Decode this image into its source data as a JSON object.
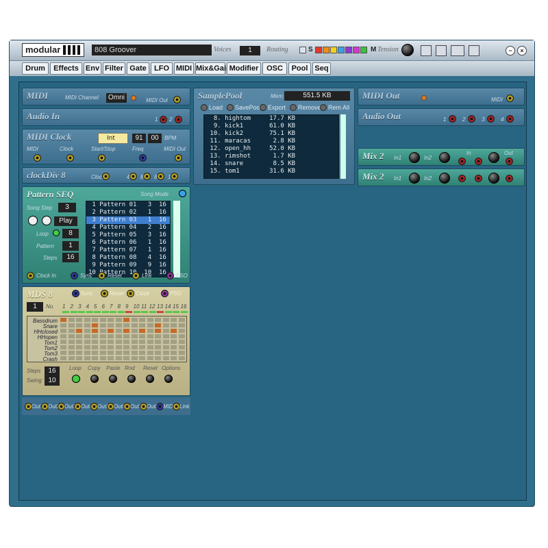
{
  "title": {
    "logo": "modular",
    "patch": "808 Groover",
    "voices_label": "Voices",
    "voices": "1",
    "routing_label": "Routing",
    "s": "S",
    "m": "M",
    "tension_label": "Tension"
  },
  "colors": {
    "rack": "#276582",
    "tan": "#c9c298",
    "teal": "#3f9586",
    "cable_yellow": "#d8c23a",
    "cable_red": "#b0282a",
    "cable_blue": "#3a4ec4"
  },
  "routing_swatches": [
    "#d9e4ee",
    "#e23a2a",
    "#f08a1a",
    "#f2d21a",
    "#3aa0e8",
    "#8a3ad0",
    "#d03ad0",
    "#3ac23a"
  ],
  "toolbar_icons": [
    "disk-icon",
    "save-as-icon",
    "grid-icon",
    "pages-icon"
  ],
  "menu": [
    "Drum",
    "Effects",
    "Env",
    "Filter",
    "Gate",
    "LFO",
    "MIDI",
    "Mix&Gain",
    "Modifier",
    "OSC",
    "Pool",
    "Seq"
  ],
  "midi": {
    "title": "MIDI",
    "ch_label": "MIDI Channel",
    "ch": "Omni",
    "out": "MIDI Out"
  },
  "audio_in": {
    "title": "Audio In",
    "p1": "1",
    "p2": "2"
  },
  "clock": {
    "title": "MIDI Clock",
    "int": "Int",
    "bpm1": "91",
    "bpm2": "00",
    "bpm": "BPM",
    "ports": [
      "MIDI",
      "Clock",
      "Start/Stop",
      "Freq",
      "MIDI Out"
    ]
  },
  "clockdiv": {
    "title": "clockDiv 8",
    "ports": [
      "Clock",
      "4",
      "8",
      "8T",
      "16"
    ]
  },
  "seq": {
    "title": "Pattern SEQ",
    "mode": "Song Mode",
    "step_label": "Song Step",
    "step": "3",
    "play": "Play",
    "loop_label": "Loop",
    "loop": "8",
    "pattern_label": "Pattern",
    "pattern": "1",
    "steps_label": "Steps",
    "steps": "16",
    "rows": [
      [
        "1",
        "Pattern 01",
        "3",
        "16"
      ],
      [
        "2",
        "Pattern 02",
        "1",
        "16"
      ],
      [
        "3",
        "Pattern 03",
        "1",
        "16"
      ],
      [
        "4",
        "Pattern 04",
        "2",
        "16"
      ],
      [
        "5",
        "Pattern 05",
        "3",
        "16"
      ],
      [
        "6",
        "Pattern 06",
        "1",
        "16"
      ],
      [
        "7",
        "Pattern 07",
        "1",
        "16"
      ],
      [
        "8",
        "Pattern 08",
        "4",
        "16"
      ],
      [
        "9",
        "Pattern 09",
        "9",
        "16"
      ],
      [
        "10",
        "Pattern 10",
        "10",
        "16"
      ]
    ],
    "ports": [
      "Clock In",
      "Sync",
      "Reset",
      "Link",
      "PSO"
    ]
  },
  "mds": {
    "title": "MDS 8",
    "no_num": "1",
    "no_label": "No.",
    "nums": [
      "1",
      "2",
      "3",
      "4",
      "5",
      "6",
      "7",
      "8",
      "9",
      "10",
      "11",
      "12",
      "13",
      "14",
      "15",
      "16"
    ],
    "tracks": [
      "Bassdrum",
      "Snare",
      "HHclosed",
      "HHopen",
      "Tom1",
      "Tom2",
      "Tom3",
      "Crash"
    ],
    "side_ports": [
      "Sync",
      "Reset",
      "Clock",
      "PSO"
    ],
    "steps_label": "Steps",
    "steps": "16",
    "swing_label": "Swing",
    "swing": "10",
    "buttons": [
      "Loop",
      "Copy",
      "Paste",
      "Rnd",
      "Reset",
      "Options"
    ],
    "outs": [
      "Out1",
      "Out2",
      "Out3",
      "Out4",
      "Out5",
      "Out6",
      "Out7",
      "Out8",
      "MIDI",
      "Link"
    ]
  },
  "pool": {
    "title": "SamplePool",
    "mem_label": "Mem",
    "mem": "551.5 KB",
    "buttons": [
      "Load",
      "SavePool",
      "Export",
      "Remove",
      "Rem All"
    ],
    "rows": [
      [
        "8.",
        "hightom",
        "17.7 KB"
      ],
      [
        "9.",
        "kick1",
        "61.0 KB"
      ],
      [
        "10.",
        "kick2",
        "75.1 KB"
      ],
      [
        "11.",
        "maracas",
        "2.8 KB"
      ],
      [
        "12.",
        "open_hh",
        "52.0 KB"
      ],
      [
        "13.",
        "rimshot",
        "1.7 KB"
      ],
      [
        "14.",
        "snare",
        "8.5 KB"
      ],
      [
        "15.",
        "tom1",
        "31.6 KB"
      ]
    ]
  },
  "midi_out": {
    "title": "MIDI Out",
    "midi": "MIDI"
  },
  "audio_out": {
    "title": "Audio Out",
    "p": [
      "1",
      "2",
      "3",
      "4"
    ]
  },
  "mix2": {
    "title": "Mix 2",
    "in1": "In1",
    "in2": "In2",
    "in": "In",
    "out": "Out"
  }
}
